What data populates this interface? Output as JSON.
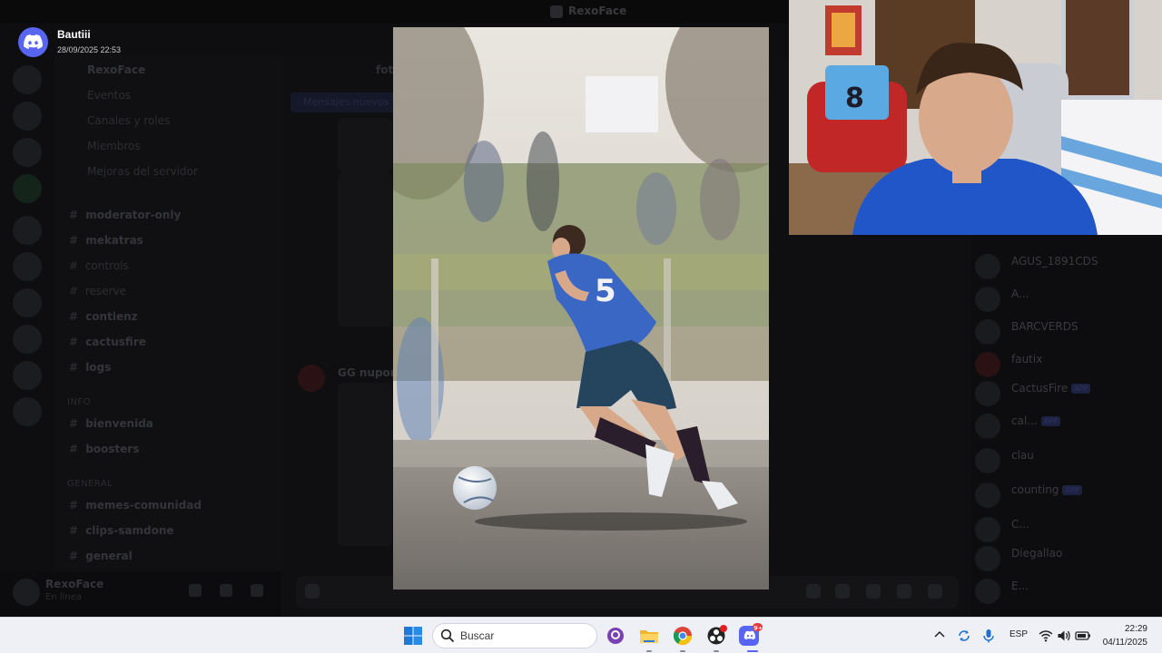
{
  "notification": {
    "sender": "Bautiii",
    "timestamp": "28/09/2025 22:53",
    "icon": "discord-icon"
  },
  "discord": {
    "window_title": "RexoFace",
    "server_name": "RexoFace",
    "top_items": [
      "Eventos",
      "Canales y roles",
      "Miembros",
      "Mejoras del servidor"
    ],
    "channels": [
      {
        "label": "moderator-only"
      },
      {
        "label": "mekatras"
      },
      {
        "label": "controls"
      },
      {
        "label": "reserve"
      },
      {
        "label": "contienz"
      },
      {
        "label": "cactusfire"
      },
      {
        "label": "logs"
      }
    ],
    "category_info": "INFO",
    "info_channels": [
      "bienvenida",
      "boosters"
    ],
    "category_general": "GENERAL",
    "general_channels": [
      "memes-comunidad",
      "clips-samdone",
      "general"
    ],
    "chat_header": "fotos-ju",
    "new_messages_banner": "Mensajes nuevos",
    "chat_author": "GG nuportos",
    "user": {
      "name": "RexoFace",
      "status": "En línea"
    },
    "members": [
      {
        "name": "AGUS_1891CDS",
        "tag": "",
        "activity": ""
      },
      {
        "name": "A...",
        "tag": "",
        "activity": ""
      },
      {
        "name": "BARCVERDS",
        "tag": "",
        "activity": ""
      },
      {
        "name": "fautix",
        "tag": "",
        "activity": ""
      },
      {
        "name": "CactusFire",
        "tag": "APP",
        "activity": ""
      },
      {
        "name": "cal...",
        "tag": "APP",
        "activity": ""
      },
      {
        "name": "clau",
        "tag": "",
        "activity": ""
      },
      {
        "name": "counting",
        "tag": "APP",
        "activity": ""
      },
      {
        "name": "C...",
        "tag": "",
        "activity": ""
      },
      {
        "name": "Diegallao",
        "tag": "",
        "activity": ""
      },
      {
        "name": "E...",
        "tag": "",
        "activity": ""
      }
    ]
  },
  "photo": {
    "jersey_number": "5",
    "subject": "youth soccer player dribbling a ball"
  },
  "taskbar": {
    "search_placeholder": "Buscar",
    "language": "ESP",
    "time": "22:29",
    "date": "04/11/2025",
    "discord_badge": "9+",
    "apps": [
      "start-icon",
      "search-icon",
      "github-desktop-icon",
      "file-explorer-icon",
      "chrome-icon",
      "obs-icon",
      "discord-icon"
    ],
    "tray": [
      "chevron-up-icon",
      "sync-icon",
      "microphone-icon",
      "wifi-icon",
      "volume-icon",
      "battery-icon"
    ]
  },
  "colors": {
    "discord_blurple": "#5865f2",
    "taskbar_bg": "#eef0f6",
    "jersey_blue": "#3a66c4"
  }
}
